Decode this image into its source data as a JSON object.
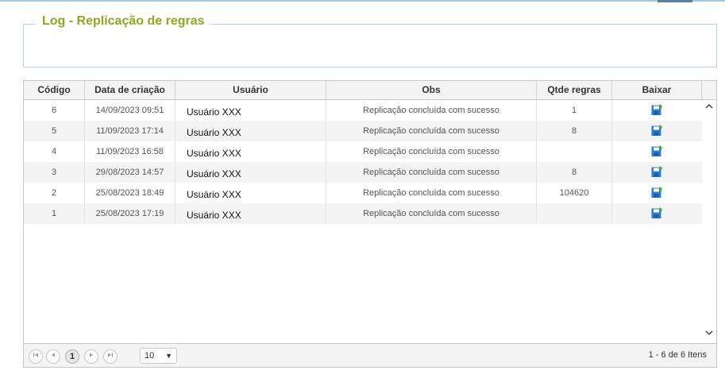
{
  "panel": {
    "title": "Log - Replicação de regras"
  },
  "table": {
    "columns": [
      "Código",
      "Data de criação",
      "Usuário",
      "Obs",
      "Qtde regras",
      "Baixar"
    ],
    "rows": [
      {
        "codigo": "6",
        "data": "14/09/2023 09:51",
        "usuario": "Usuário XXX",
        "obs": "Replicação concluída com sucesso",
        "qtde": "1"
      },
      {
        "codigo": "5",
        "data": "11/09/2023 17:14",
        "usuario": "Usuário XXX",
        "obs": "Replicação concluída com sucesso",
        "qtde": "8"
      },
      {
        "codigo": "4",
        "data": "11/09/2023 16:58",
        "usuario": "Usuário XXX",
        "obs": "Replicação concluída com sucesso",
        "qtde": ""
      },
      {
        "codigo": "3",
        "data": "29/08/2023 14:57",
        "usuario": "Usuário XXX",
        "obs": "Replicação concluída com sucesso",
        "qtde": "8"
      },
      {
        "codigo": "2",
        "data": "25/08/2023 18:49",
        "usuario": "Usuário XXX",
        "obs": "Replicação concluída com sucesso",
        "qtde": "104620"
      },
      {
        "codigo": "1",
        "data": "25/08/2023 17:19",
        "usuario": "Usuário XXX",
        "obs": "Replicação concluída com sucesso",
        "qtde": ""
      }
    ]
  },
  "pager": {
    "first_icon": "first-page-icon",
    "prev_icon": "prev-page-icon",
    "current_page": "1",
    "next_icon": "next-page-icon",
    "last_icon": "last-page-icon",
    "page_size": "10",
    "info": "1 - 6 de 6 Itens"
  },
  "icons": {
    "download": "save-download-icon",
    "scroll_up": "chevron-up-icon",
    "scroll_down": "chevron-down-icon"
  },
  "colors": {
    "title": "#8aaa1f",
    "border": "#b9d3e6",
    "download_icon": "#2a7fd4",
    "download_arrow": "#4caf2a"
  }
}
